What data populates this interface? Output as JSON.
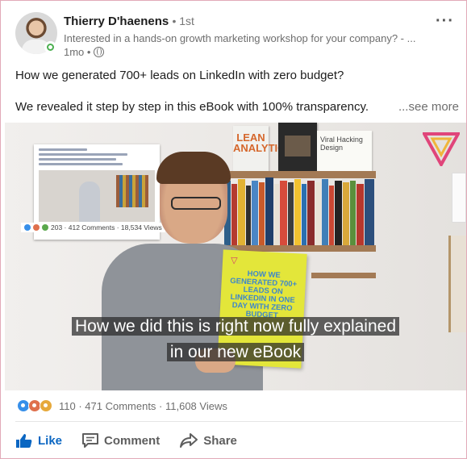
{
  "author": {
    "name": "Thierry D'haenens",
    "degree": "• 1st",
    "headline": "Interested in a hands-on growth marketing workshop for your company? - ...",
    "time": "1mo •"
  },
  "post": {
    "line1": "How we generated 700+ leads on LinkedIn with zero budget?",
    "line2": "We revealed it step by step in this eBook with 100% transparency.",
    "see_more": "...see more"
  },
  "video": {
    "caption_line1": "How we did this is right now fully explained",
    "caption_line2": "in our new eBook",
    "book_lean": "LEAN ANALYTICS",
    "book_viral": "Viral Hacking Design",
    "thumb_stats": "203 · 412 Comments · 18,534 Views",
    "ebook_title": "HOW WE GENERATED 700+ LEADS ON LINKEDIN IN ONE DAY WITH ZERO BUDGET"
  },
  "social": {
    "reactions": [
      "like",
      "love",
      "celebrate"
    ],
    "counts": "110 · 471 Comments · 11,608 Views"
  },
  "actions": {
    "like": "Like",
    "comment": "Comment",
    "share": "Share"
  },
  "colors": {
    "accent_blue": "#0a66c2",
    "like_reaction": "#378fe9",
    "love_reaction": "#df704d",
    "celebrate_reaction": "#e6a93b",
    "online_green": "#4caf50"
  },
  "icons": [
    "globe-icon",
    "more-options-icon",
    "like-icon",
    "comment-icon",
    "share-icon"
  ]
}
